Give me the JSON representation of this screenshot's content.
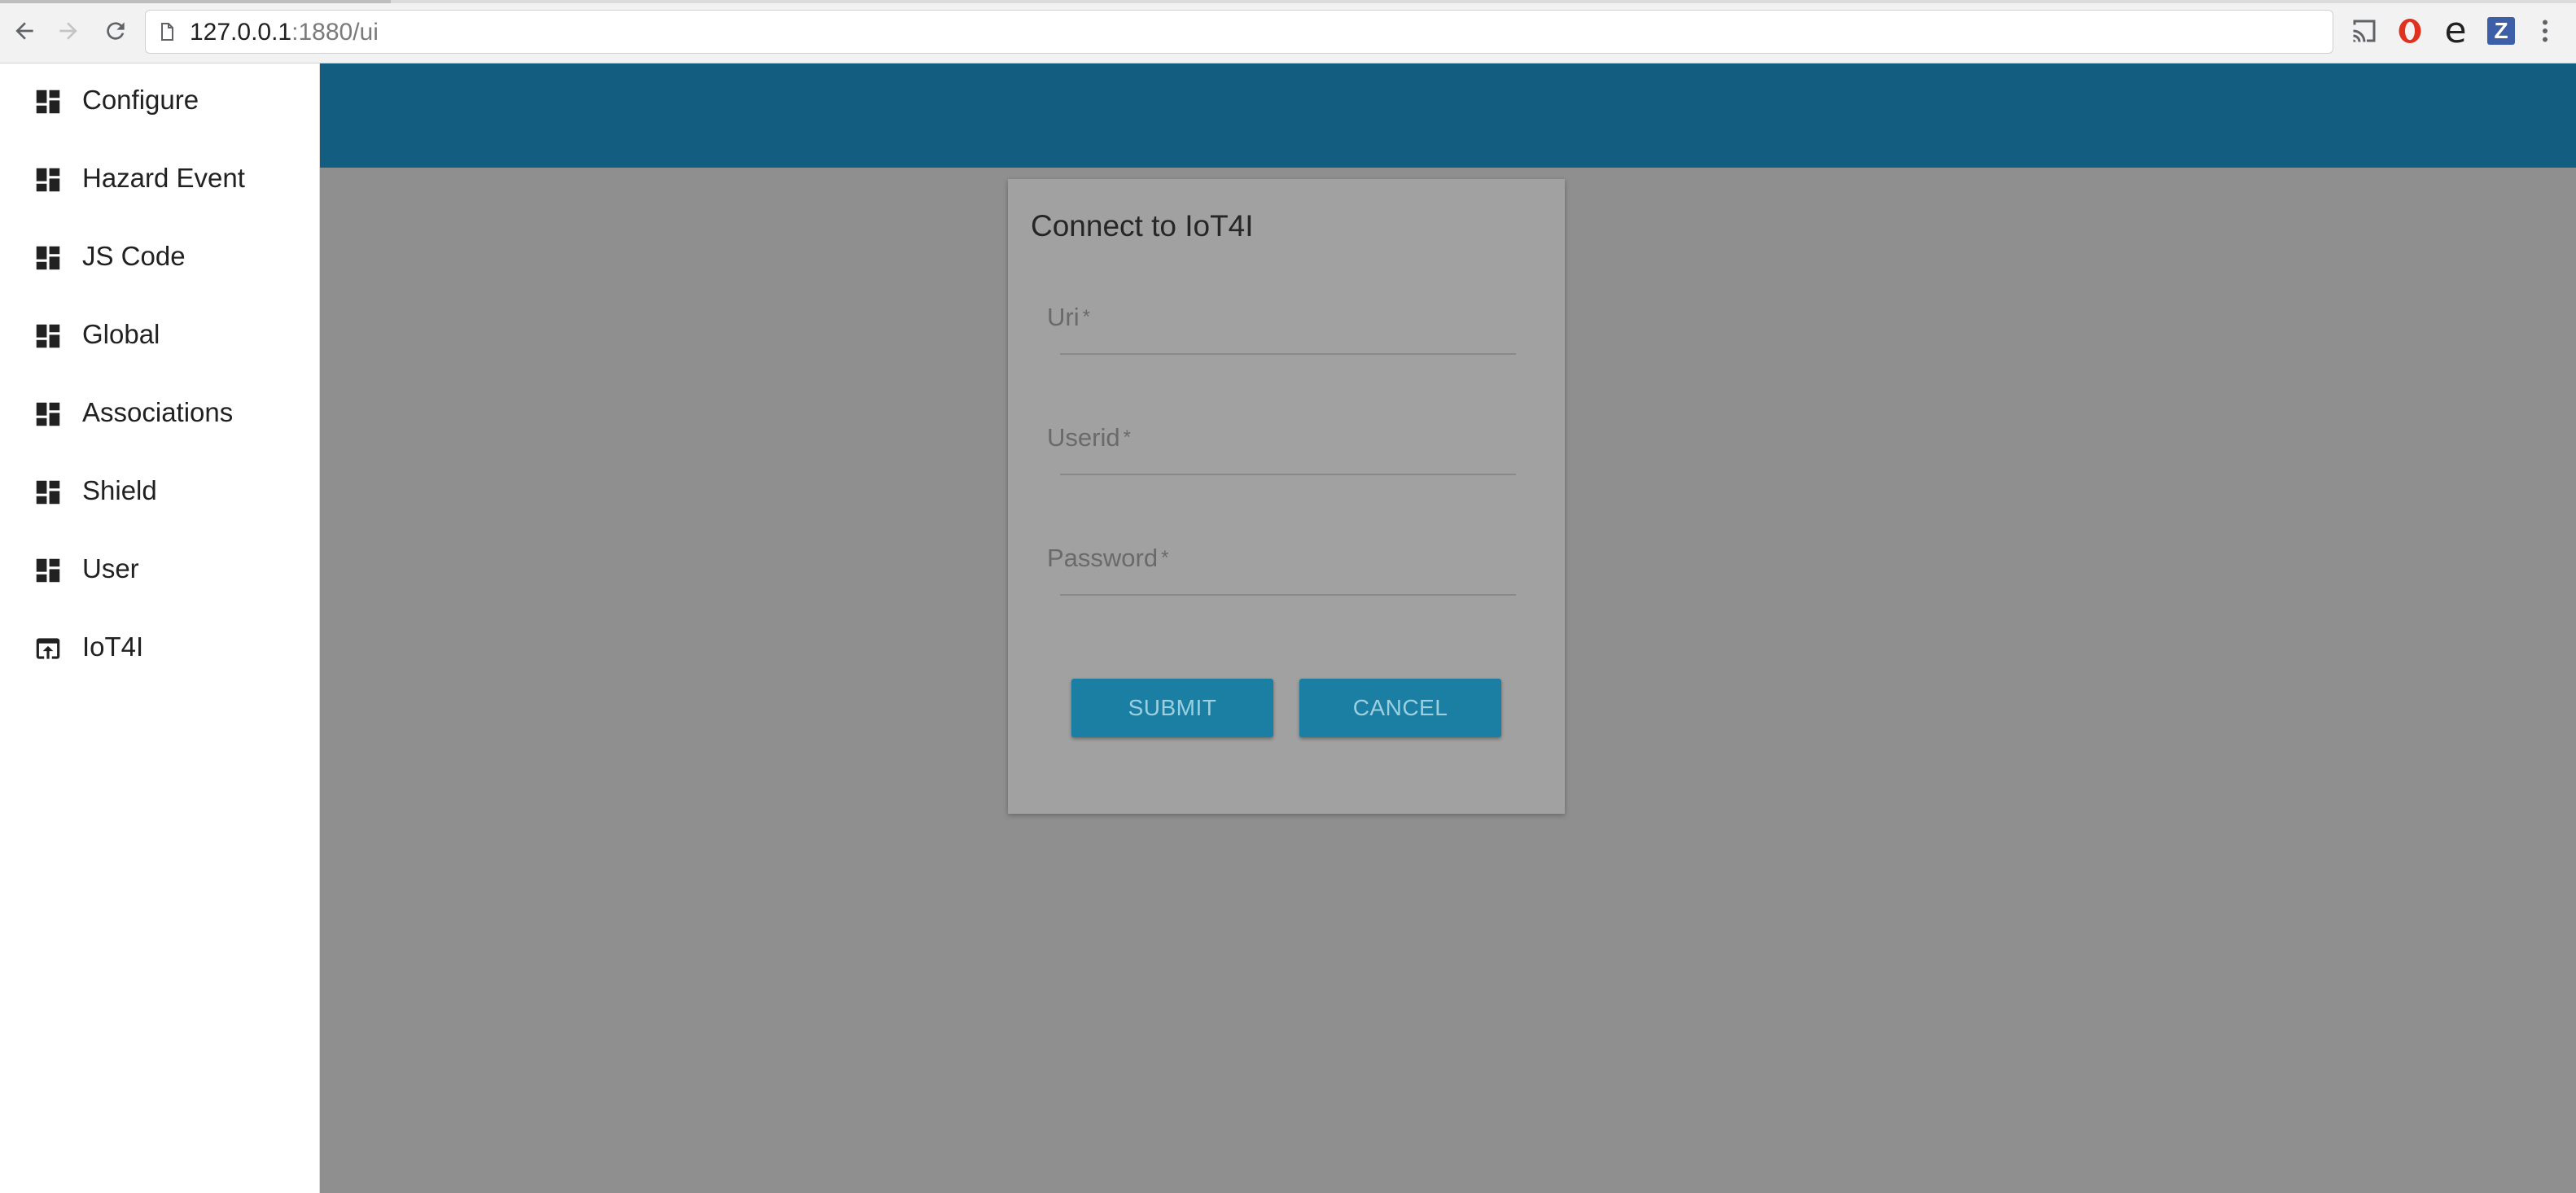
{
  "browser": {
    "url_host": "127.0.0.1",
    "url_path": ":1880/ui",
    "icons": {
      "back": "arrow-left-icon",
      "forward": "arrow-right-icon",
      "reload": "reload-icon",
      "page": "page-icon",
      "cast": "cast-icon",
      "opera": "opera-icon",
      "e_ext": "e",
      "z_ext": "Z",
      "menu": "kebab-menu-icon"
    }
  },
  "sidebar": {
    "items": [
      {
        "label": "Configure",
        "icon": "dashboard-icon"
      },
      {
        "label": "Hazard Event",
        "icon": "dashboard-icon"
      },
      {
        "label": "JS Code",
        "icon": "dashboard-icon"
      },
      {
        "label": "Global",
        "icon": "dashboard-icon"
      },
      {
        "label": "Associations",
        "icon": "dashboard-icon"
      },
      {
        "label": "Shield",
        "icon": "dashboard-icon"
      },
      {
        "label": "User",
        "icon": "dashboard-icon"
      },
      {
        "label": "IoT4I",
        "icon": "open-in-browser-icon"
      }
    ]
  },
  "theme": {
    "toolbar_color": "#125d80",
    "overlay_color": "#8f8f8f",
    "button_color": "#1b7ea3"
  },
  "dialog": {
    "title": "Connect to IoT4I",
    "fields": [
      {
        "label": "Uri",
        "required_marker": "*",
        "value": ""
      },
      {
        "label": "Userid",
        "required_marker": "*",
        "value": ""
      },
      {
        "label": "Password",
        "required_marker": "*",
        "value": ""
      }
    ],
    "submit_label": "SUBMIT",
    "cancel_label": "CANCEL"
  }
}
